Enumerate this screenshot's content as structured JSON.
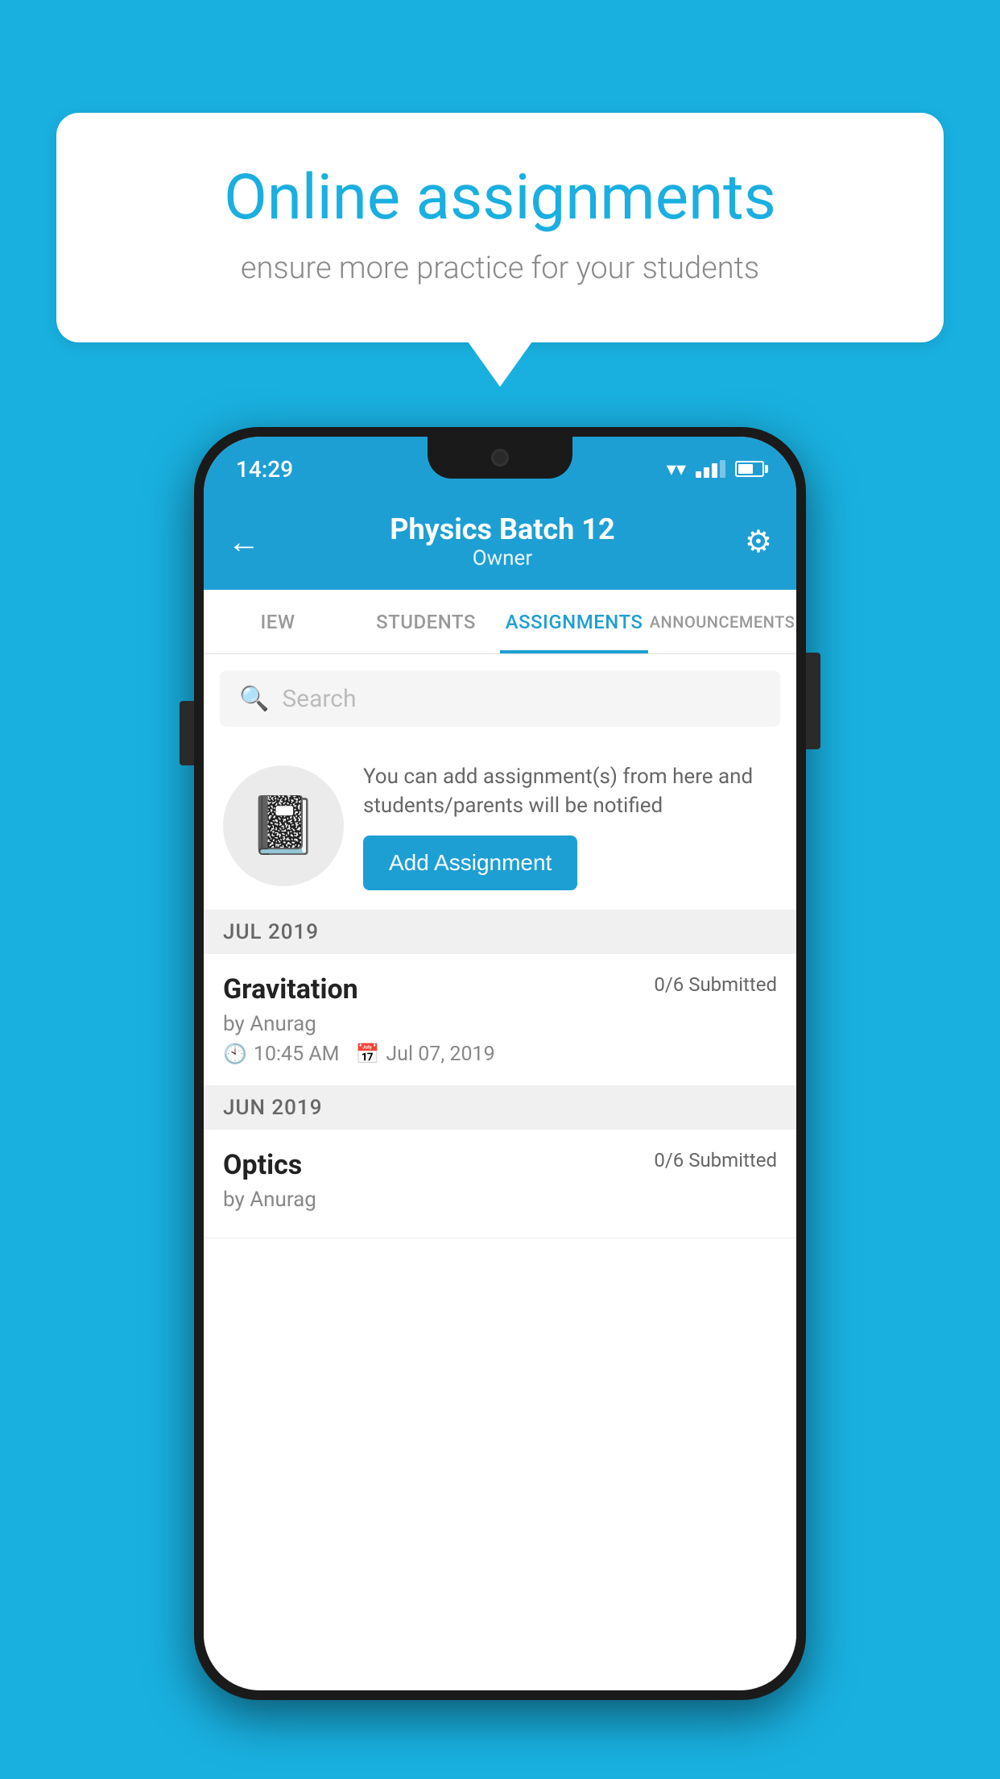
{
  "background_color": "#19b0e0",
  "speech_bubble": {
    "title": "Online assignments",
    "subtitle": "ensure more practice for your students"
  },
  "phone": {
    "status_bar": {
      "time": "14:29"
    },
    "header": {
      "title": "Physics Batch 12",
      "subtitle": "Owner",
      "back_label": "←",
      "settings_label": "⚙"
    },
    "tabs": [
      {
        "label": "IEW",
        "active": false
      },
      {
        "label": "STUDENTS",
        "active": false
      },
      {
        "label": "ASSIGNMENTS",
        "active": true
      },
      {
        "label": "ANNOUNCEMENTS",
        "active": false
      }
    ],
    "search": {
      "placeholder": "Search"
    },
    "promo": {
      "description": "You can add assignment(s) from here and students/parents will be notified",
      "button_label": "Add Assignment"
    },
    "assignment_groups": [
      {
        "month": "JUL 2019",
        "assignments": [
          {
            "title": "Gravitation",
            "submitted": "0/6 Submitted",
            "by": "by Anurag",
            "time": "10:45 AM",
            "date": "Jul 07, 2019"
          }
        ]
      },
      {
        "month": "JUN 2019",
        "assignments": [
          {
            "title": "Optics",
            "submitted": "0/6 Submitted",
            "by": "by Anurag",
            "time": "",
            "date": ""
          }
        ]
      }
    ]
  }
}
